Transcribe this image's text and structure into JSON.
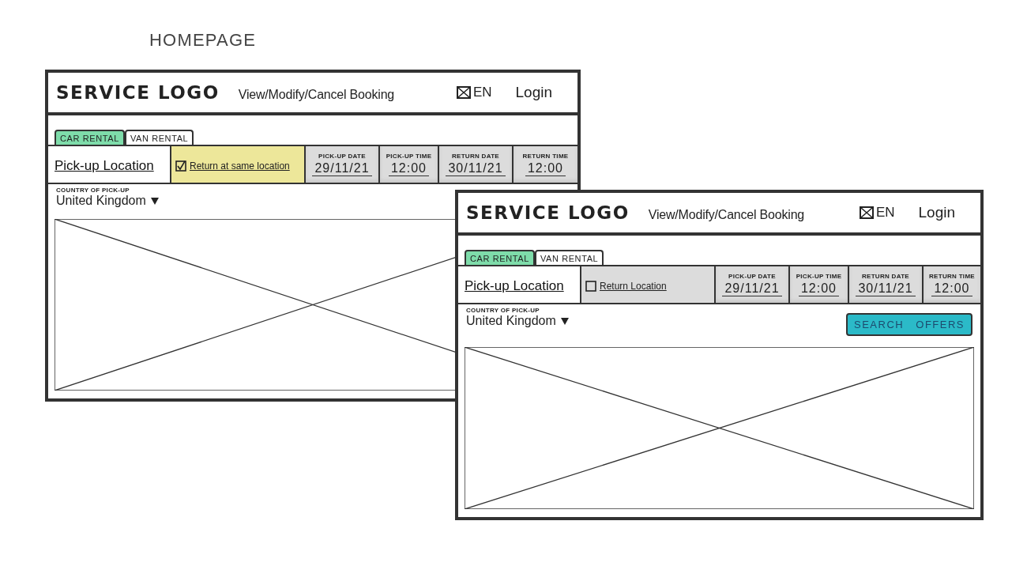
{
  "page_title": "HOMEPAGE",
  "wireframes": [
    {
      "header": {
        "logo": "SERVICE LOGO",
        "nav_link": "View/Modify/Cancel Booking",
        "language": "EN",
        "login": "Login"
      },
      "tabs": [
        {
          "label": "CAR RENTAL",
          "selected": true
        },
        {
          "label": "VAN RENTAL",
          "selected": false
        }
      ],
      "fields": [
        {
          "kind": "location",
          "placeholder": "Pick-up Location"
        },
        {
          "kind": "checkbox",
          "label": "Return at same location",
          "checked": true
        },
        {
          "kind": "date",
          "label": "PICK-UP DATE",
          "value": "29/11/21"
        },
        {
          "kind": "time",
          "label": "PICK-UP TIME",
          "value": "12:00"
        },
        {
          "kind": "date",
          "label": "RETURN DATE",
          "value": "30/11/21"
        },
        {
          "kind": "time",
          "label": "RETURN TIME",
          "value": "12:00"
        }
      ],
      "country": {
        "label": "COUNTRY OF PICK-UP",
        "value": "United Kingdom"
      }
    },
    {
      "header": {
        "logo": "SERVICE LOGO",
        "nav_link": "View/Modify/Cancel Booking",
        "language": "EN",
        "login": "Login"
      },
      "tabs": [
        {
          "label": "CAR RENTAL",
          "selected": true
        },
        {
          "label": "VAN RENTAL",
          "selected": false
        }
      ],
      "fields": [
        {
          "kind": "location",
          "placeholder": "Pick-up Location"
        },
        {
          "kind": "checkbox",
          "label": "Return Location",
          "checked": false
        },
        {
          "kind": "date",
          "label": "PICK-UP DATE",
          "value": "29/11/21"
        },
        {
          "kind": "time",
          "label": "PICK-UP TIME",
          "value": "12:00"
        },
        {
          "kind": "date",
          "label": "RETURN DATE",
          "value": "30/11/21"
        },
        {
          "kind": "time",
          "label": "RETURN TIME",
          "value": "12:00"
        }
      ],
      "country": {
        "label": "COUNTRY OF PICK-UP",
        "value": "United Kingdom"
      },
      "search_button": "SEARCH OFFERS"
    }
  ]
}
